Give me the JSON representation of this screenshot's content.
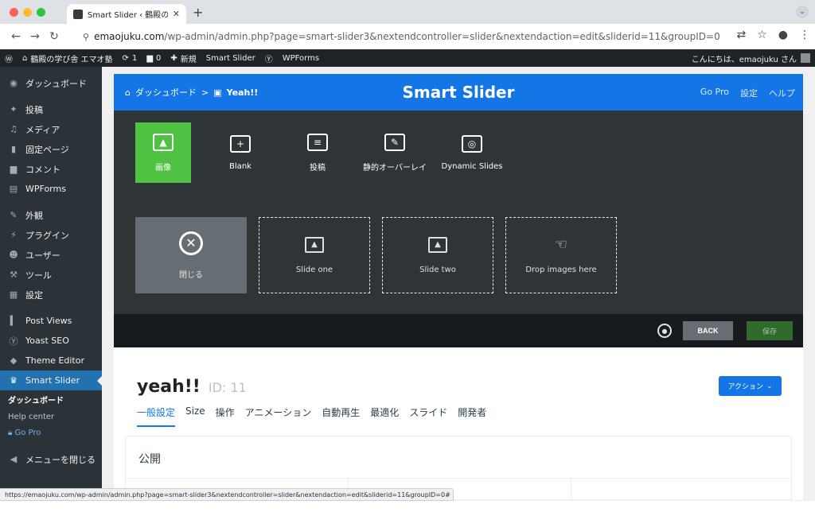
{
  "browser": {
    "tab_title": "Smart Slider ‹ 鶴殿の学び舎 エ",
    "url_prefix": "emaojuku.com",
    "url_path": "/wp-admin/admin.php?page=smart-slider3&nextendcontroller=slider&nextendaction=edit&sliderid=11&groupID=0",
    "status_url": "https://emaojuku.com/wp-admin/admin.php?page=smart-slider3&nextendcontroller=slider&nextendaction=edit&sliderid=11&groupID=0#"
  },
  "adminbar": {
    "site_name": "鶴殿の学び舎 エマオ塾",
    "updates": "1",
    "comments": "0",
    "new": "新規",
    "smart_slider": "Smart Slider",
    "wpforms": "WPForms",
    "greeting": "こんにちは、emaojuku さん"
  },
  "sidebar": {
    "items": [
      {
        "label": "ダッシュボード",
        "icon": "dashboard-icon"
      },
      {
        "label": "投稿",
        "icon": "pin-icon"
      },
      {
        "label": "メディア",
        "icon": "media-icon"
      },
      {
        "label": "固定ページ",
        "icon": "page-icon"
      },
      {
        "label": "コメント",
        "icon": "comment-icon"
      },
      {
        "label": "WPForms",
        "icon": "forms-icon"
      },
      {
        "label": "外観",
        "icon": "brush-icon"
      },
      {
        "label": "プラグイン",
        "icon": "plugin-icon"
      },
      {
        "label": "ユーザー",
        "icon": "user-icon"
      },
      {
        "label": "ツール",
        "icon": "wrench-icon"
      },
      {
        "label": "設定",
        "icon": "settings-icon"
      },
      {
        "label": "Post Views",
        "icon": "bars-icon"
      },
      {
        "label": "Yoast SEO",
        "icon": "yoast-icon"
      },
      {
        "label": "Theme Editor",
        "icon": "diamond-icon"
      },
      {
        "label": "Smart Slider",
        "icon": "graduation-cap-icon"
      }
    ],
    "sub": {
      "dashboard": "ダッシュボード",
      "help": "Help center",
      "gopro": "Go Pro"
    },
    "collapse": "メニューを閉じる"
  },
  "header": {
    "crumb_home": "ダッシュボード",
    "crumb_sep": ">",
    "crumb_current": "Yeah!!",
    "brand": "Smart Slider",
    "go_pro": "Go Pro",
    "settings": "設定",
    "help": "ヘルプ"
  },
  "types": [
    {
      "label": "画像",
      "glyph": "▲"
    },
    {
      "label": "Blank",
      "glyph": "+"
    },
    {
      "label": "投稿",
      "glyph": "≡"
    },
    {
      "label": "静的オーバーレイ",
      "glyph": "✎"
    },
    {
      "label": "Dynamic Slides",
      "glyph": "◎"
    }
  ],
  "slides": {
    "close": "閉じる",
    "one": "Slide one",
    "two": "Slide two",
    "drop": "Drop images here"
  },
  "actions": {
    "back": "BACK",
    "save": "保存"
  },
  "slider": {
    "name": "yeah!!",
    "id": "ID: 11",
    "action_btn": "アクション"
  },
  "tabs": [
    "一般設定",
    "Size",
    "操作",
    "アニメーション",
    "自動再生",
    "最適化",
    "スライド",
    "開発者"
  ],
  "section": {
    "title": "公開"
  },
  "colors": {
    "accent": "#1375e6",
    "green": "#4fc243",
    "wp_dark": "#1d2327"
  }
}
